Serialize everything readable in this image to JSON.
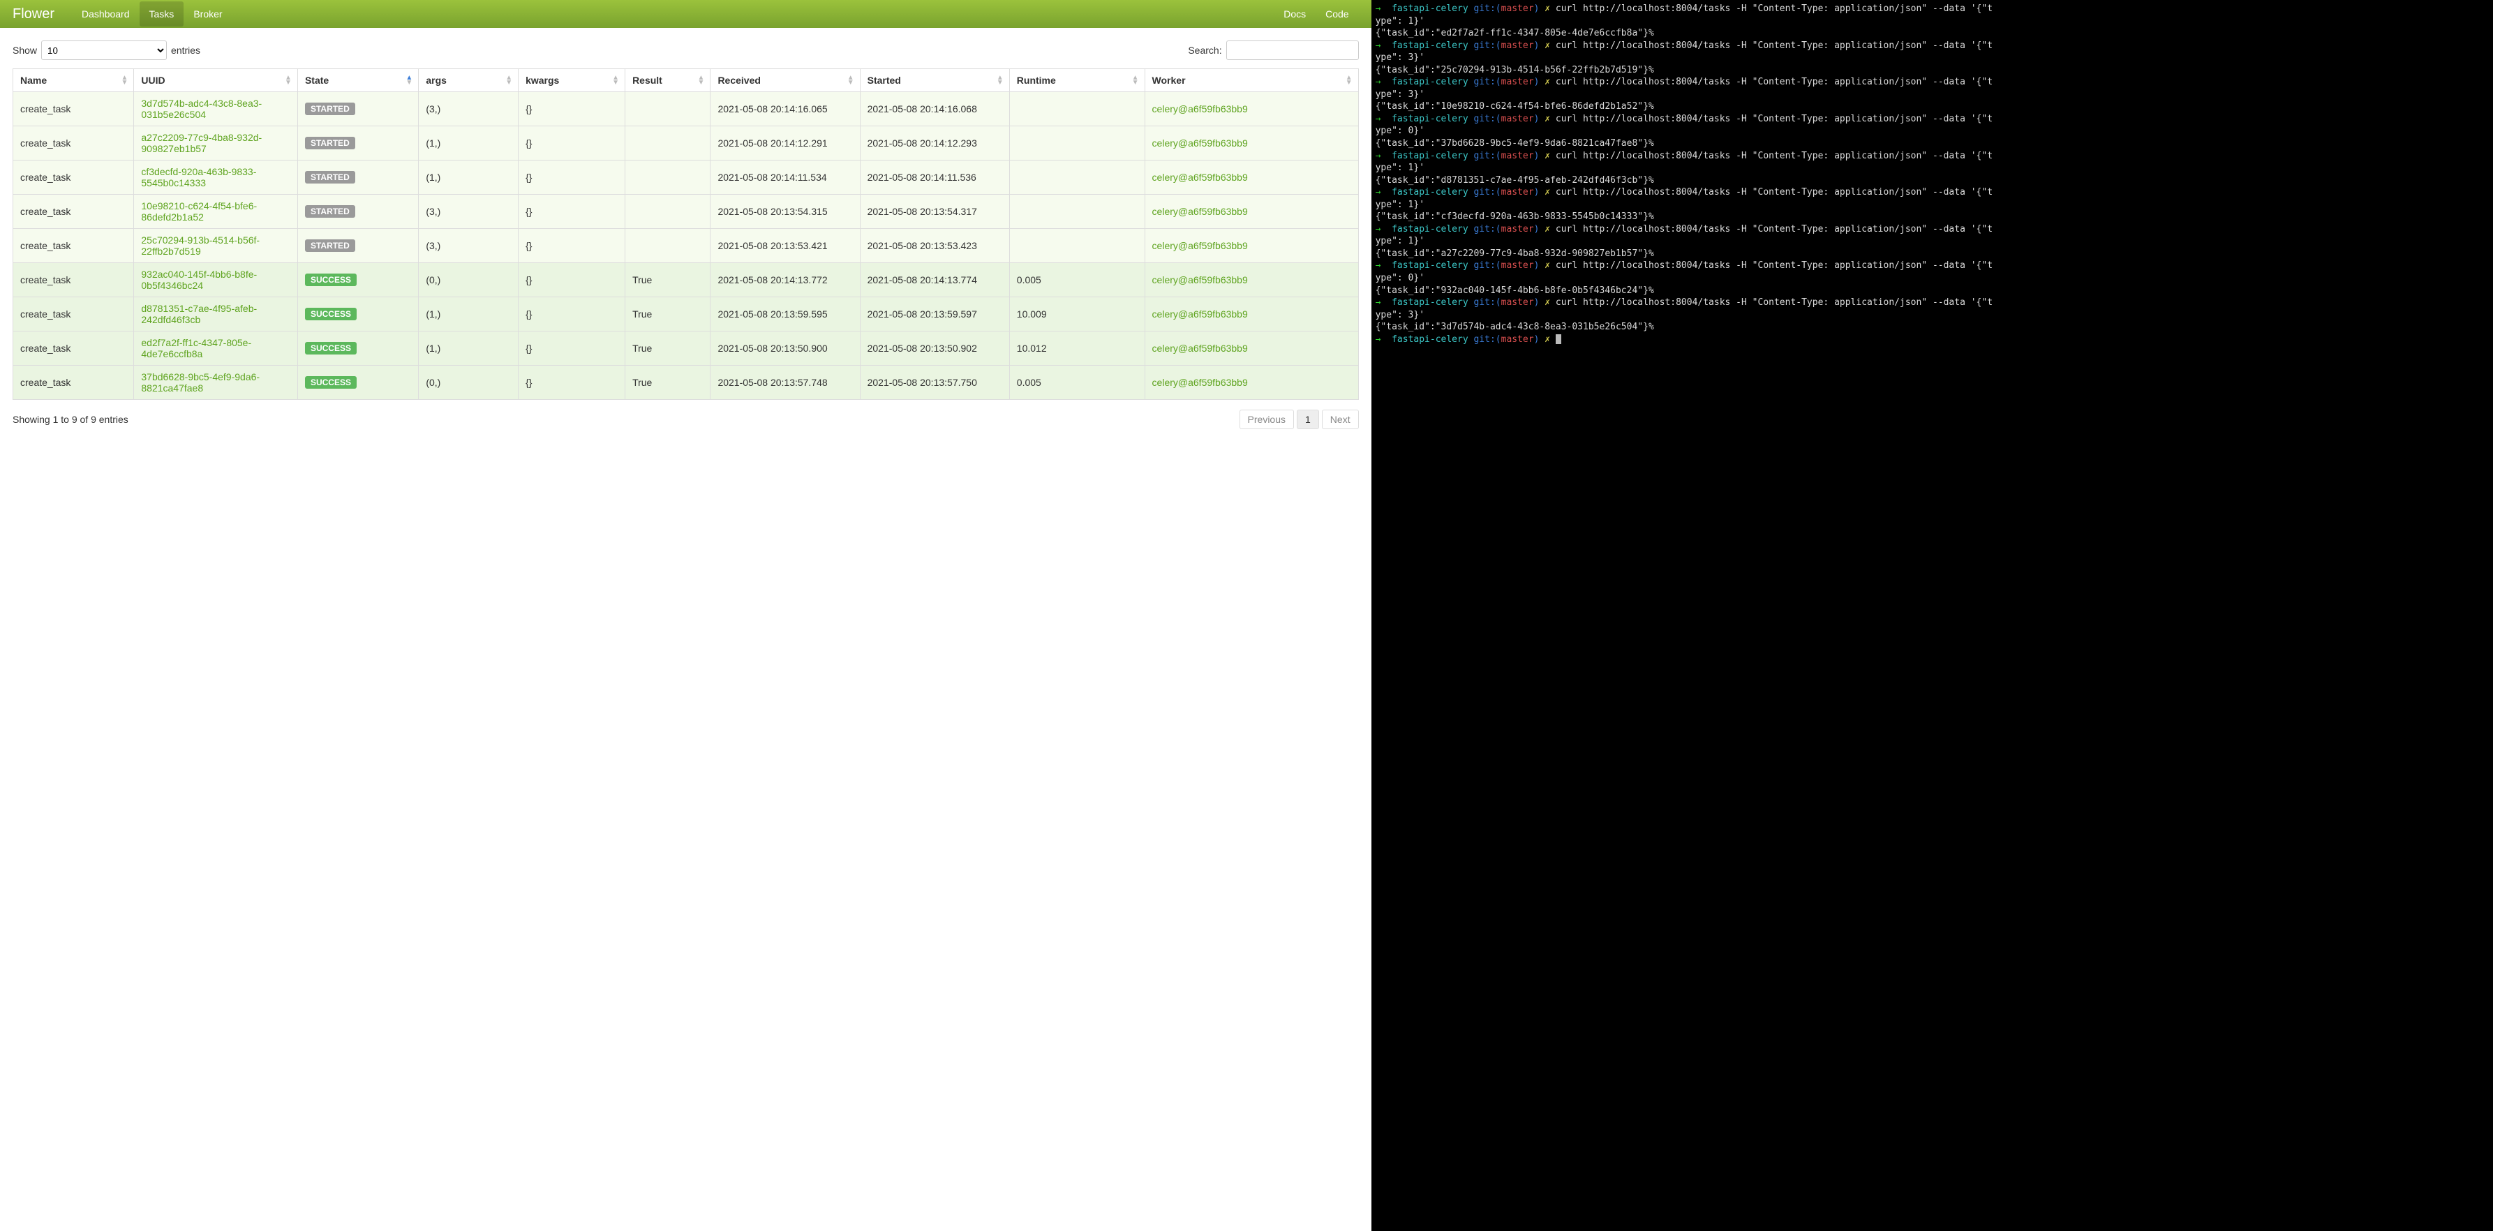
{
  "nav": {
    "brand": "Flower",
    "items": [
      "Dashboard",
      "Tasks",
      "Broker"
    ],
    "active": "Tasks",
    "right": [
      "Docs",
      "Code"
    ]
  },
  "controls": {
    "show_label_pre": "Show",
    "show_label_post": "entries",
    "page_size": "10",
    "search_label": "Search:"
  },
  "columns": [
    "Name",
    "UUID",
    "State",
    "args",
    "kwargs",
    "Result",
    "Received",
    "Started",
    "Runtime",
    "Worker"
  ],
  "sorted_col": "State",
  "rows": [
    {
      "name": "create_task",
      "uuid": "3d7d574b-adc4-43c8-8ea3-031b5e26c504",
      "state": "STARTED",
      "args": "(3,)",
      "kwargs": "{}",
      "result": "",
      "received": "2021-05-08 20:14:16.065",
      "started": "2021-05-08 20:14:16.068",
      "runtime": "",
      "worker": "celery@a6f59fb63bb9"
    },
    {
      "name": "create_task",
      "uuid": "a27c2209-77c9-4ba8-932d-909827eb1b57",
      "state": "STARTED",
      "args": "(1,)",
      "kwargs": "{}",
      "result": "",
      "received": "2021-05-08 20:14:12.291",
      "started": "2021-05-08 20:14:12.293",
      "runtime": "",
      "worker": "celery@a6f59fb63bb9"
    },
    {
      "name": "create_task",
      "uuid": "cf3decfd-920a-463b-9833-5545b0c14333",
      "state": "STARTED",
      "args": "(1,)",
      "kwargs": "{}",
      "result": "",
      "received": "2021-05-08 20:14:11.534",
      "started": "2021-05-08 20:14:11.536",
      "runtime": "",
      "worker": "celery@a6f59fb63bb9"
    },
    {
      "name": "create_task",
      "uuid": "10e98210-c624-4f54-bfe6-86defd2b1a52",
      "state": "STARTED",
      "args": "(3,)",
      "kwargs": "{}",
      "result": "",
      "received": "2021-05-08 20:13:54.315",
      "started": "2021-05-08 20:13:54.317",
      "runtime": "",
      "worker": "celery@a6f59fb63bb9"
    },
    {
      "name": "create_task",
      "uuid": "25c70294-913b-4514-b56f-22ffb2b7d519",
      "state": "STARTED",
      "args": "(3,)",
      "kwargs": "{}",
      "result": "",
      "received": "2021-05-08 20:13:53.421",
      "started": "2021-05-08 20:13:53.423",
      "runtime": "",
      "worker": "celery@a6f59fb63bb9"
    },
    {
      "name": "create_task",
      "uuid": "932ac040-145f-4bb6-b8fe-0b5f4346bc24",
      "state": "SUCCESS",
      "args": "(0,)",
      "kwargs": "{}",
      "result": "True",
      "received": "2021-05-08 20:14:13.772",
      "started": "2021-05-08 20:14:13.774",
      "runtime": "0.005",
      "worker": "celery@a6f59fb63bb9"
    },
    {
      "name": "create_task",
      "uuid": "d8781351-c7ae-4f95-afeb-242dfd46f3cb",
      "state": "SUCCESS",
      "args": "(1,)",
      "kwargs": "{}",
      "result": "True",
      "received": "2021-05-08 20:13:59.595",
      "started": "2021-05-08 20:13:59.597",
      "runtime": "10.009",
      "worker": "celery@a6f59fb63bb9"
    },
    {
      "name": "create_task",
      "uuid": "ed2f7a2f-ff1c-4347-805e-4de7e6ccfb8a",
      "state": "SUCCESS",
      "args": "(1,)",
      "kwargs": "{}",
      "result": "True",
      "received": "2021-05-08 20:13:50.900",
      "started": "2021-05-08 20:13:50.902",
      "runtime": "10.012",
      "worker": "celery@a6f59fb63bb9"
    },
    {
      "name": "create_task",
      "uuid": "37bd6628-9bc5-4ef9-9da6-8821ca47fae8",
      "state": "SUCCESS",
      "args": "(0,)",
      "kwargs": "{}",
      "result": "True",
      "received": "2021-05-08 20:13:57.748",
      "started": "2021-05-08 20:13:57.750",
      "runtime": "0.005",
      "worker": "celery@a6f59fb63bb9"
    }
  ],
  "footer": {
    "info": "Showing 1 to 9 of 9 entries",
    "prev": "Previous",
    "next": "Next",
    "page": "1"
  },
  "terminal": {
    "prompt": {
      "arrow": "→",
      "path": "fastapi-celery",
      "git": "git:(",
      "branch": "master",
      "git2": ")",
      "x": "✗"
    },
    "cmd": "curl http://localhost:8004/tasks -H \"Content-Type: application/json\" --data '{\"type\": TYPE}'",
    "events": [
      {
        "type": "1",
        "out": "{\"task_id\":\"ed2f7a2f-ff1c-4347-805e-4de7e6ccfb8a\"}"
      },
      {
        "type": "3",
        "out": "{\"task_id\":\"25c70294-913b-4514-b56f-22ffb2b7d519\"}"
      },
      {
        "type": "3",
        "out": "{\"task_id\":\"10e98210-c624-4f54-bfe6-86defd2b1a52\"}"
      },
      {
        "type": "0",
        "out": "{\"task_id\":\"37bd6628-9bc5-4ef9-9da6-8821ca47fae8\"}"
      },
      {
        "type": "1",
        "out": "{\"task_id\":\"d8781351-c7ae-4f95-afeb-242dfd46f3cb\"}"
      },
      {
        "type": "1",
        "out": "{\"task_id\":\"cf3decfd-920a-463b-9833-5545b0c14333\"}"
      },
      {
        "type": "1",
        "out": "{\"task_id\":\"a27c2209-77c9-4ba8-932d-909827eb1b57\"}"
      },
      {
        "type": "0",
        "out": "{\"task_id\":\"932ac040-145f-4bb6-b8fe-0b5f4346bc24\"}"
      },
      {
        "type": "3",
        "out": "{\"task_id\":\"3d7d574b-adc4-43c8-8ea3-031b5e26c504\"}"
      }
    ]
  }
}
